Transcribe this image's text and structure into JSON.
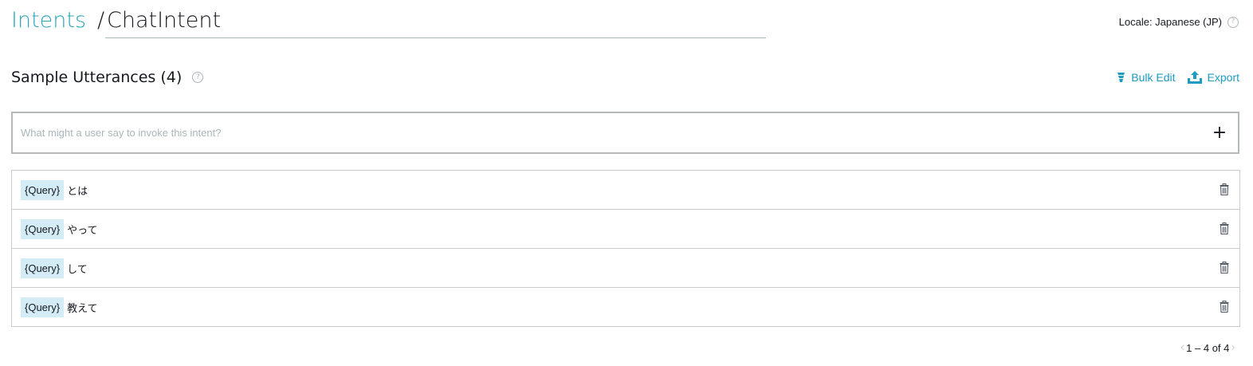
{
  "breadcrumb": {
    "root": "Intents",
    "separator": "/",
    "current": "ChatIntent"
  },
  "locale": {
    "label": "Locale: Japanese (JP)",
    "help_icon": "question-circle-icon"
  },
  "section": {
    "title": "Sample Utterances (4)",
    "help_icon": "question-circle-icon"
  },
  "actions": {
    "bulk_edit_label": "Bulk Edit",
    "export_label": "Export",
    "accent_color": "#1e9bc1"
  },
  "input": {
    "placeholder": "What might a user say to invoke this intent?",
    "value": "",
    "add_icon": "plus-icon",
    "add_label": "+"
  },
  "utterances": [
    {
      "slot": "{Query}",
      "text": "とは"
    },
    {
      "slot": "{Query}",
      "text": "やって"
    },
    {
      "slot": "{Query}",
      "text": "して"
    },
    {
      "slot": "{Query}",
      "text": "教えて"
    }
  ],
  "pagination": {
    "prev_label": "‹",
    "range": "1 – 4 of 4",
    "next_label": "›"
  },
  "colors": {
    "link": "#2ba6b8",
    "slot_background": "#d4ecf6"
  }
}
